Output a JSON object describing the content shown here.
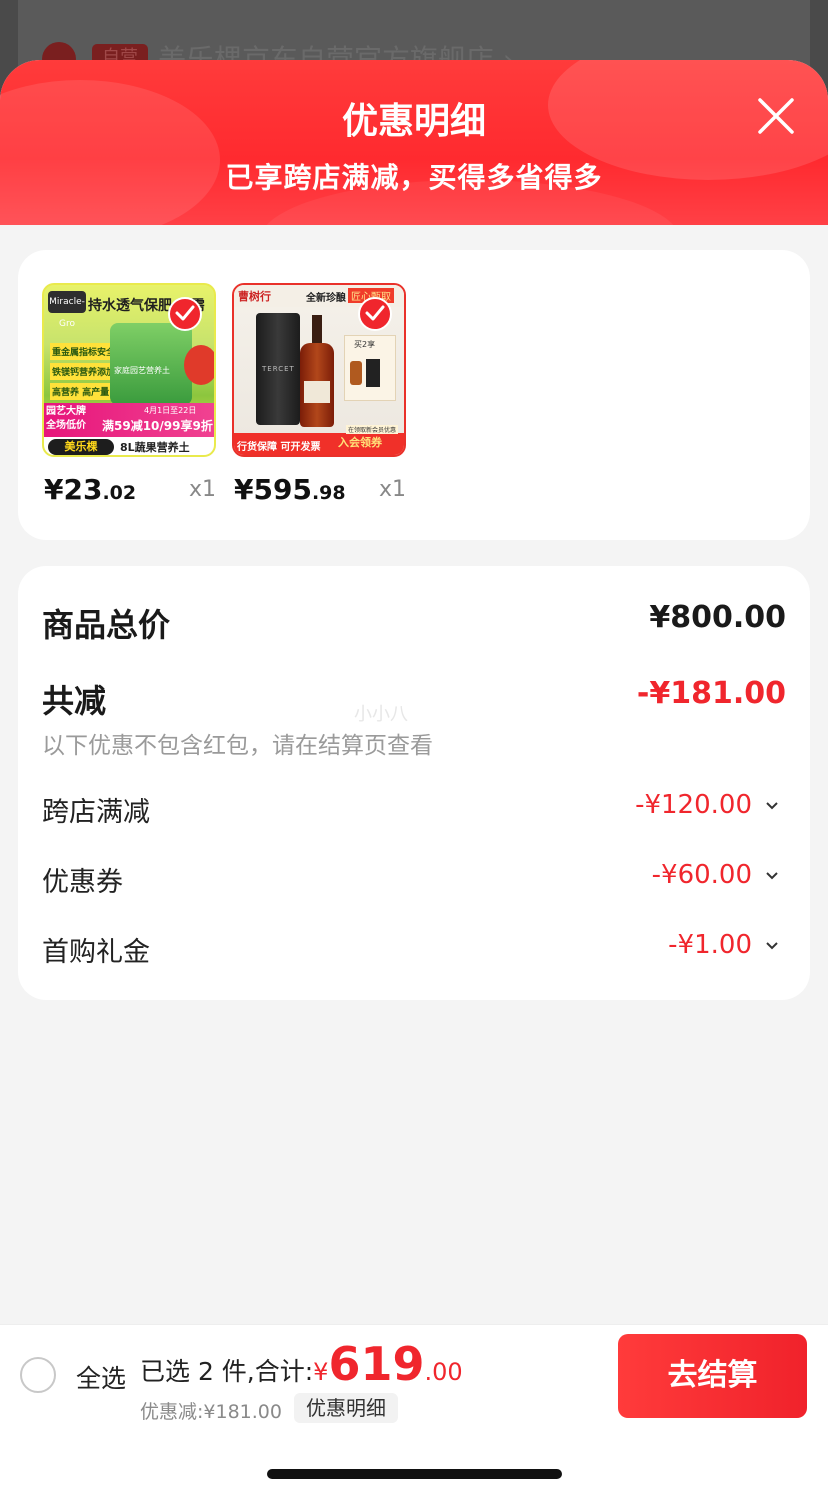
{
  "background_store": {
    "badge": "自营",
    "name": "美乐棵京东自营官方旗舰店 ›"
  },
  "sheet": {
    "title": "优惠明细",
    "subtitle": "已享跨店满减，买得多省得多",
    "close_icon": "close-icon"
  },
  "products": [
    {
      "price_int": "¥23",
      "price_dec": ".02",
      "qty": "x1",
      "image": {
        "logo": "Miracle-Gro",
        "headline": "持水透气保肥 无需",
        "tags": [
          "重金属指标安全",
          "铁镁钙营养添加",
          "高营养 高产量"
        ],
        "bag_label": "家庭园艺营养土",
        "promo_a": "园艺大牌\n全场低价",
        "promo_date": "4月1日至22日",
        "promo_b": "满59减10/99享9折",
        "brand": "美乐棵",
        "spec": "8L蔬果营养土"
      }
    },
    {
      "price_int": "¥595",
      "price_dec": ".98",
      "qty": "x1",
      "image": {
        "shop": "曹树行",
        "headline": "全新珍酿",
        "tag": "匠心甄取",
        "box_text": "TERCET",
        "gift": "买2享",
        "bottom_a": "行货保障 可开发票",
        "bottom_small": "在领取新会员优惠",
        "bottom_b": "入会领券"
      }
    }
  ],
  "summary": {
    "total_label": "商品总价",
    "total_value": "¥800.00",
    "reduce_label": "共减",
    "reduce_value": "-¥181.00",
    "note": "以下优惠不包含红包，请在结算页查看",
    "discounts": [
      {
        "label": "跨店满减",
        "value": "-¥120.00"
      },
      {
        "label": "优惠券",
        "value": "-¥60.00"
      },
      {
        "label": "首购礼金",
        "value": "-¥1.00"
      }
    ]
  },
  "watermark": "小小八",
  "bottom_bar": {
    "select_all": "全选",
    "selected_prefix": "已选 2 件,合计:",
    "sum_yen": "¥",
    "sum_int": "619",
    "sum_dec": ".00",
    "saved": "优惠减:¥181.00",
    "detail_chip": "优惠明细",
    "checkout": "去结算"
  },
  "colors": {
    "accent": "#f0262d",
    "header_gradient_start": "#ff3b3b"
  }
}
